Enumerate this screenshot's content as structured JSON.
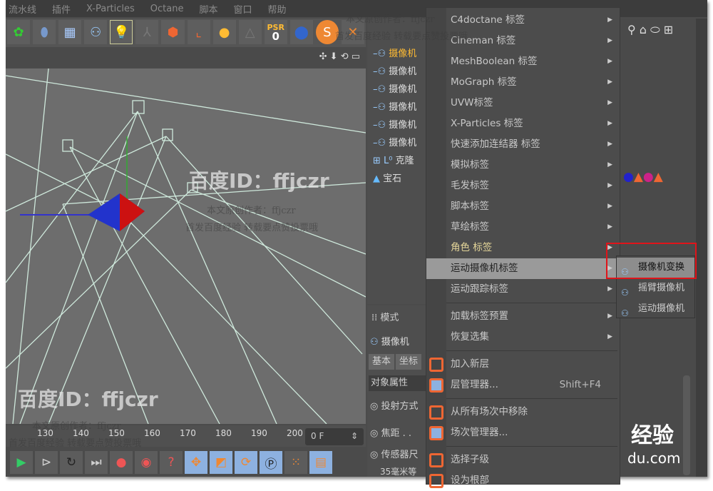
{
  "menubar": [
    "流水线",
    "插件",
    "X-Particles",
    "Octane",
    "脚本",
    "窗口",
    "帮助"
  ],
  "toolbar": {
    "psr_label": "PSR",
    "psr_value": "0"
  },
  "timeline": {
    "ticks": [
      "130",
      "140",
      "150",
      "160",
      "170",
      "180",
      "190",
      "200"
    ],
    "frame": "0 F"
  },
  "object_manager": {
    "items": [
      "摄像机",
      "摄像机",
      "摄像机",
      "摄像机",
      "摄像机",
      "摄像机",
      "克隆",
      "宝石"
    ]
  },
  "attributes": {
    "mode": "模式",
    "object": "摄像机",
    "tabs": [
      "基本",
      "坐标"
    ],
    "section": "对象属性",
    "fields": [
      "投射方式",
      "焦距 . .",
      "传感器尺",
      "35毫米等"
    ]
  },
  "context_menu": {
    "items": [
      {
        "label": "C4doctane 标签",
        "sub": true
      },
      {
        "label": "Cineman 标签",
        "sub": true
      },
      {
        "label": "MeshBoolean 标签",
        "sub": true
      },
      {
        "label": "MoGraph 标签",
        "sub": true
      },
      {
        "label": "UVW标签",
        "sub": true
      },
      {
        "label": "X-Particles 标签",
        "sub": true
      },
      {
        "label": "快速添加连结器 标签",
        "sub": true
      },
      {
        "label": "模拟标签",
        "sub": true
      },
      {
        "label": "毛发标签",
        "sub": true
      },
      {
        "label": "脚本标签",
        "sub": true
      },
      {
        "label": "草绘标签",
        "sub": true
      },
      {
        "label": "角色 标签",
        "sub": true
      },
      {
        "label": "运动摄像机标签",
        "sub": true,
        "highlighted": true
      },
      {
        "label": "运动跟踪标签",
        "sub": true
      },
      {
        "label": "加载标签预置",
        "sub": true
      },
      {
        "label": "恢复选集",
        "sub": true
      },
      {
        "label": "加入新层"
      },
      {
        "label": "层管理器...",
        "shortcut": "Shift+F4"
      },
      {
        "label": "从所有场次中移除"
      },
      {
        "label": "场次管理器..."
      },
      {
        "label": "选择子级"
      },
      {
        "label": "设为根部"
      }
    ]
  },
  "submenu": {
    "items": [
      {
        "label": "摄像机变换",
        "highlighted": true
      },
      {
        "label": "摇臂摄像机"
      },
      {
        "label": "运动摄像机"
      }
    ]
  },
  "watermarks": {
    "id": "百度ID：ffjczr",
    "author": "本文原创作者：ffjczr",
    "note": "首发百度经验 转载要点赞投票哦",
    "brand": "经验",
    "domain": "du.com"
  },
  "colors": {
    "highlight_box": "#e0141a",
    "accent_blue": "#8db1e0"
  }
}
